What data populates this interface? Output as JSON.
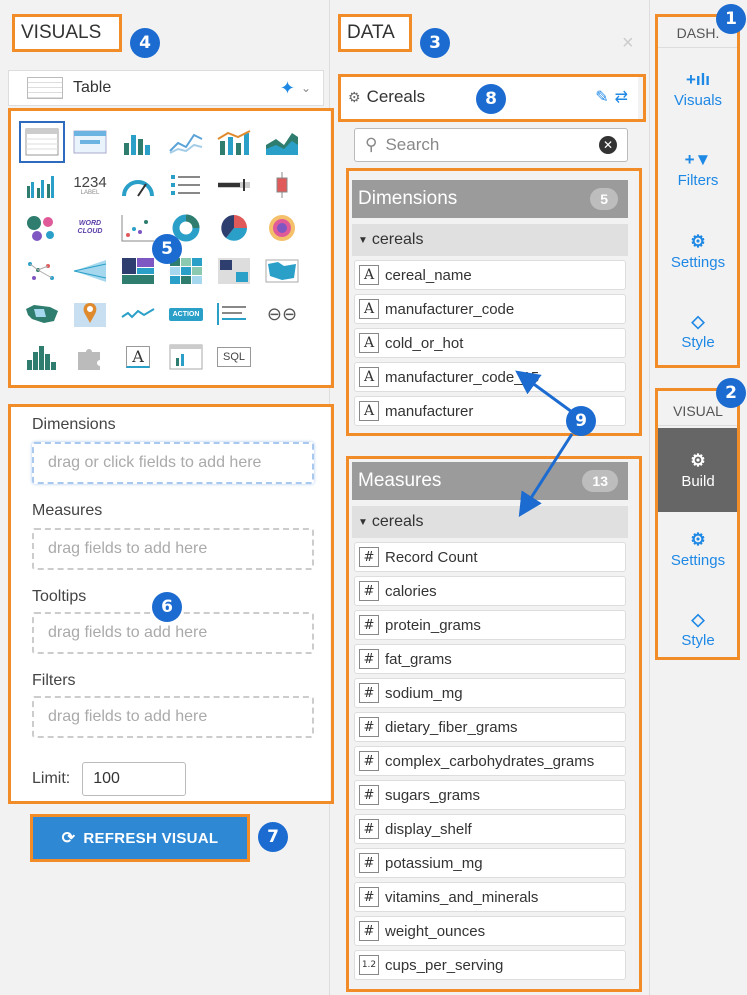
{
  "visuals": {
    "title": "VISUALS",
    "type_label": "Table",
    "shelves": {
      "dimensions_label": "Dimensions",
      "dimensions_placeholder": "drag or click fields to add here",
      "measures_label": "Measures",
      "measures_placeholder": "drag fields to add here",
      "tooltips_label": "Tooltips",
      "tooltips_placeholder": "drag fields to add here",
      "filters_label": "Filters",
      "filters_placeholder": "drag fields to add here",
      "limit_label": "Limit:",
      "limit_value": "100"
    },
    "refresh_label": "REFRESH VISUAL",
    "gallery_text": {
      "label_1234": "1234",
      "label_sub": "LABEL",
      "word_cloud": "WORD CLOUD",
      "action": "ACTION",
      "text_a": "A",
      "sql": "SQL"
    }
  },
  "data": {
    "title": "DATA",
    "close": "×",
    "dataset": "Cereals",
    "search_placeholder": "Search",
    "dimensions": {
      "title": "Dimensions",
      "count": "5",
      "group": "cereals",
      "fields": [
        "cereal_name",
        "manufacturer_code",
        "cold_or_hot",
        "manufacturer_code_15",
        "manufacturer"
      ]
    },
    "measures": {
      "title": "Measures",
      "count": "13",
      "group": "cereals",
      "fields": [
        "Record Count",
        "calories",
        "protein_grams",
        "fat_grams",
        "sodium_mg",
        "dietary_fiber_grams",
        "complex_carbohydrates_grams",
        "sugars_grams",
        "display_shelf",
        "potassium_mg",
        "vitamins_and_minerals",
        "weight_ounces",
        "cups_per_serving"
      ],
      "last_field_icon": "1.2"
    }
  },
  "rail": {
    "dash_title": "DASH.",
    "dash_items": [
      {
        "label": "Visuals",
        "icon": "+ılı"
      },
      {
        "label": "Filters",
        "icon": "+▼"
      },
      {
        "label": "Settings",
        "icon": "⚙"
      },
      {
        "label": "Style",
        "icon": "◇"
      }
    ],
    "visual_title": "VISUAL",
    "visual_items": [
      {
        "label": "Build",
        "icon": "⚙"
      },
      {
        "label": "Settings",
        "icon": "⚙"
      },
      {
        "label": "Style",
        "icon": "◇"
      }
    ]
  },
  "callouts": [
    "1",
    "2",
    "3",
    "4",
    "5",
    "6",
    "7",
    "8",
    "9"
  ],
  "colors": {
    "accent": "#1e88e5",
    "callout_border": "#f28c28",
    "badge": "#1b6bd1",
    "button": "#2e88d4"
  }
}
